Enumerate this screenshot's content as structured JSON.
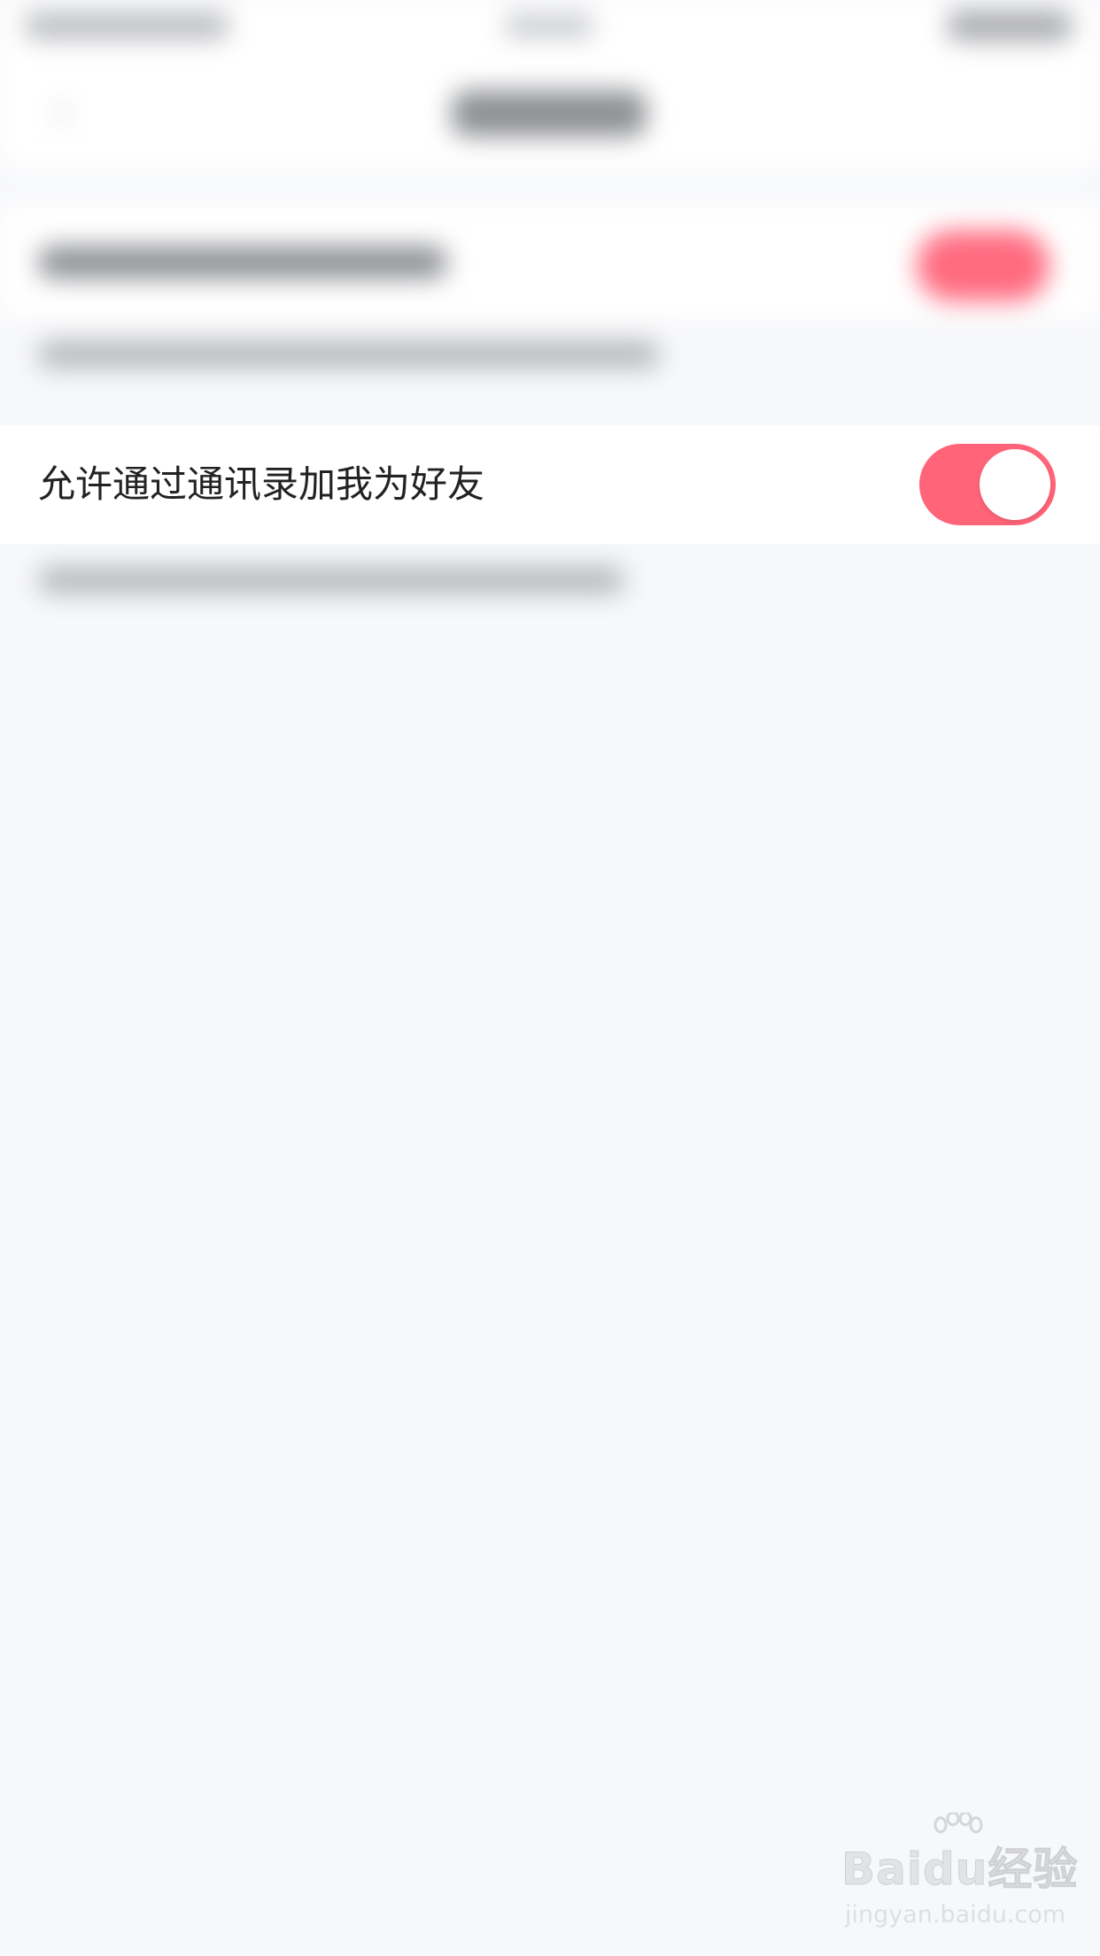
{
  "setting": {
    "label": "允许通过通讯录加我为好友",
    "enabled": true
  },
  "colors": {
    "accent": "#ff6478",
    "background": "#f7f8fa",
    "row_background": "#ffffff",
    "label_text": "#222222"
  },
  "icons": {
    "toggle": "toggle-switch-icon",
    "watermark_paw": "baidu-paw-icon"
  },
  "watermark": {
    "logo": "Baidu经验",
    "url": "jingyan.baidu.com"
  }
}
